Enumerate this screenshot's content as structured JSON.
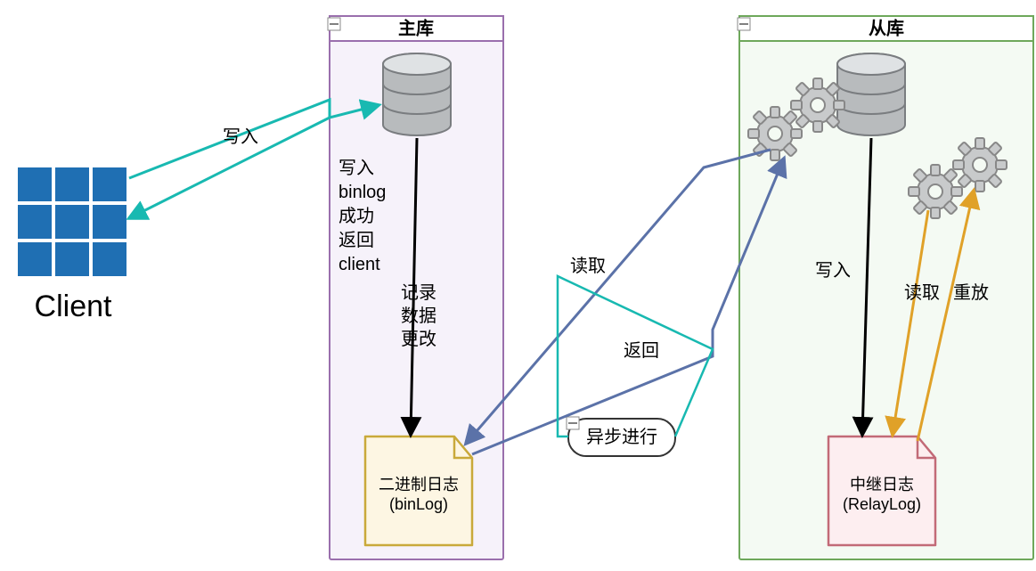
{
  "master_box": {
    "title": "主库"
  },
  "slave_box": {
    "title": "从库"
  },
  "client": {
    "label": "Client"
  },
  "binlog_file": {
    "line1": "二进制日志",
    "line2": "(binLog)"
  },
  "relaylog_file": {
    "line1": "中继日志",
    "line2": "(RelayLog)"
  },
  "async_box": {
    "label": "异步进行"
  },
  "edge_labels": {
    "write_in": "写入",
    "write_binlog_1": "写入",
    "write_binlog_2": "binlog",
    "write_binlog_3": "成功",
    "write_binlog_4": "返回",
    "write_binlog_5": "client",
    "record_1": "记录",
    "record_2": "数据",
    "record_3": "更改",
    "read": "读取",
    "return": "返回",
    "slave_write": "写入",
    "slave_read": "读取",
    "slave_replay": "重放"
  }
}
